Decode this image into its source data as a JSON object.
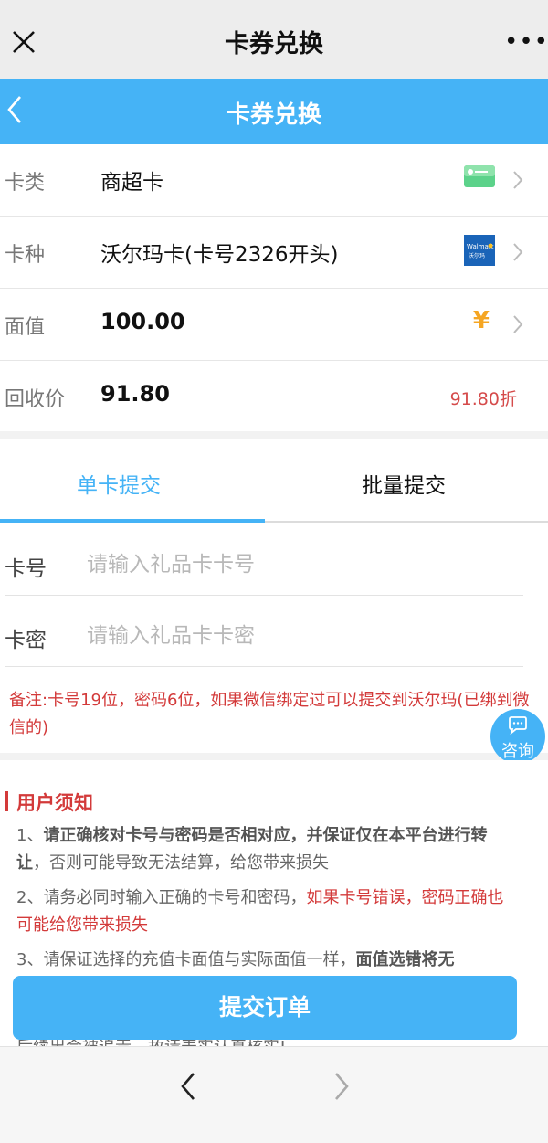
{
  "wechat_bar": {
    "title": "卡券兑换"
  },
  "nav": {
    "title": "卡券兑换"
  },
  "card_info": {
    "type": {
      "label": "卡类",
      "value": "商超卡"
    },
    "kind": {
      "label": "卡种",
      "value": "沃尔玛卡(卡号2326开头)",
      "logo_text": "Walmart",
      "logo_sub": "沃尔玛"
    },
    "face": {
      "label": "面值",
      "value": "100.00",
      "currency_symbol": "¥"
    },
    "recycle": {
      "label": "回收价",
      "value": "91.80",
      "discount": "91.80折"
    }
  },
  "tabs": {
    "single": "单卡提交",
    "batch": "批量提交"
  },
  "form": {
    "card_no": {
      "label": "卡号",
      "placeholder": "请输入礼品卡卡号"
    },
    "card_pwd": {
      "label": "卡密",
      "placeholder": "请输入礼品卡卡密"
    },
    "note": "备注:卡号19位，密码6位，如果微信绑定过可以提交到沃尔玛(已绑到微信的)"
  },
  "consult": {
    "label": "咨询"
  },
  "notice": {
    "title": "用户须知",
    "item1_prefix": "1、",
    "item1_bold": "请正确核对卡号与密码是否相对应，并保证仅在本平台进行转让",
    "item1_rest": "，否则可能导致无法结算，给您带来损失",
    "item2_prefix": "2、请务必同时输入正确的卡号和密码，",
    "item2_red": "如果卡号错误，密码正确也可能给您带来损失",
    "item3_prefix": "3、请保证选择的充值卡面值与实际面值一样，",
    "item3_bold": "面值选错将无",
    "item3_tail": "后续出会被追责，故请表实认真核实!"
  },
  "submit": {
    "label": "提交订单"
  },
  "colors": {
    "accent": "#45b3f6",
    "warning": "#d33a3a"
  }
}
